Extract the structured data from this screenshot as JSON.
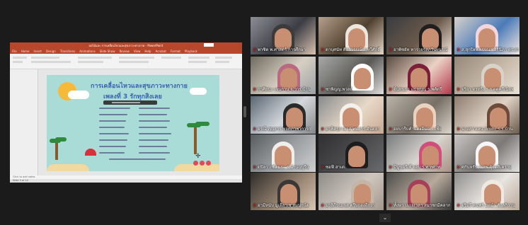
{
  "ppt": {
    "window_title": "ผลไม้และ การเคลื่อนไหวและสุขภาวะทางกาย - PowerPoint",
    "tabs": [
      "File",
      "Home",
      "Insert",
      "Design",
      "Transitions",
      "Animations",
      "Slide Show",
      "Review",
      "View",
      "Help",
      "Acrobat",
      "Format",
      "Playback"
    ],
    "slide_title": "การเคลื่อนไหวและสุขภาวะทางกาย",
    "slide_subtitle": "เพลงที่ 3 รักทุกสิงเลย",
    "notes_placeholder": "Click to add notes",
    "status_left": "Slide 3 of 12"
  },
  "participants": [
    {
      "name": "พาซิต พ.ศาสตร์.การศึกษา"
    },
    {
      "name": "ดาบุศนัท ติอาวรรณ์ ส.ทวีศักดิ์"
    },
    {
      "name": "อาพิชยัท ทารายรสภวันผนรณ์"
    },
    {
      "name": "ส.สุกปิตตพรรณา สิรินิภา ดร.ถาทิน"
    },
    {
      "name": "กาศิยนะ เจนกาน จ.วาร.บ้าน"
    },
    {
      "name": "ซาพิญญ.พวลย์"
    },
    {
      "name": "จั้นทนธา แปลญญ ร.พศ์ตรี"
    },
    {
      "name": "จริยา ทรทรีง ร.ร.ตดูครีเนิดพ"
    },
    {
      "name": "อรณี สุญสาร ขอตภวพวการก"
    },
    {
      "name": "อาฟีครุกาลาส พบสาร.ฮันตลา"
    },
    {
      "name": "อยบารีบคำแดงอีนฉ.ร.เพีย"
    },
    {
      "name": "นางสาวเลน เหยตะ ร.ร.บ้าน"
    },
    {
      "name": "ดุปิลา ภชิดมระ ร.บ้านฉบุรีน"
    },
    {
      "name": "ซอฟี สาเด"
    },
    {
      "name": "มีนูขตรีเพ๊ จอบ ร.พ.ทศาท"
    },
    {
      "name": "ศุกันหรับ จ.สพ.ตุ้ยตลิเคราม"
    },
    {
      "name": "อามีหนับ มูเฮ๊ลาเซ สมปุกน์ด"
    },
    {
      "name": "มาลิกีรณเจส ตรีบกลงถีกวา"
    },
    {
      "name": "ทั้งษา ปะเยเวลา สมาชกมีคลากส์"
    },
    {
      "name": "จริมรี คนฟร์ มอนำ สักลกิวาน"
    }
  ],
  "colors": {
    "ppt_accent": "#b7472a",
    "active_speaker_border": "#d6d84f",
    "muted_mic": "#e23030"
  },
  "pager_icon": "chevron-down-icon",
  "pager_glyph": "⌄"
}
